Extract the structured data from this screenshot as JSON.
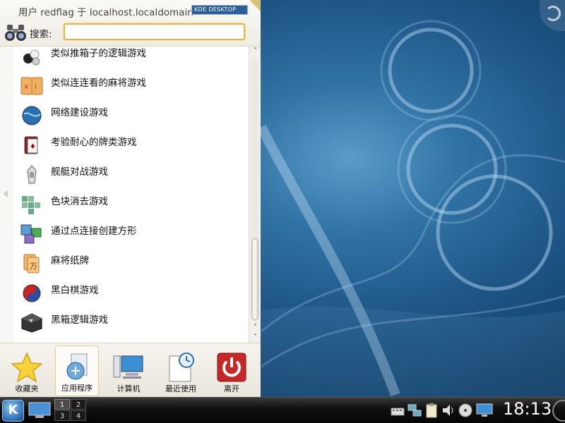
{
  "launcher": {
    "user_label": "用户 redflag 于 localhost.localdomain",
    "kde_badge": "KDE DESKTOP",
    "search_label": "搜索:",
    "search_value": "",
    "list_items": [
      {
        "label": "类似推箱子的逻辑游戏",
        "icon": "stones-icon"
      },
      {
        "label": "类似连连看的麻将游戏",
        "icon": "mahjongg-tiles-icon"
      },
      {
        "label": "网络建设游戏",
        "icon": "network-globe-icon"
      },
      {
        "label": "考验耐心的牌类游戏",
        "icon": "cards-icon"
      },
      {
        "label": "舰艇对战游戏",
        "icon": "battleship-icon"
      },
      {
        "label": "色块消去游戏",
        "icon": "color-blocks-icon"
      },
      {
        "label": "通过点连接创建方形",
        "icon": "squares-icon"
      },
      {
        "label": "麻将纸牌",
        "icon": "mahjong-card-icon"
      },
      {
        "label": "黑白棋游戏",
        "icon": "reversi-icon"
      },
      {
        "label": "黑箱逻辑游戏",
        "icon": "blackbox-icon"
      }
    ],
    "tabs": [
      {
        "label": "收藏夹",
        "icon": "star-icon"
      },
      {
        "label": "应用程序",
        "icon": "applications-icon"
      },
      {
        "label": "计算机",
        "icon": "computer-icon"
      },
      {
        "label": "最近使用",
        "icon": "recent-document-icon"
      },
      {
        "label": "离开",
        "icon": "power-icon"
      }
    ]
  },
  "taskbar": {
    "kickoff_label": "K",
    "pager": [
      "1",
      "2",
      "3",
      "4"
    ],
    "clock": "18:13"
  },
  "colors": {
    "search_border": "#e6b54a",
    "wallpaper": "#1d5585",
    "power_button": "#c62828"
  }
}
